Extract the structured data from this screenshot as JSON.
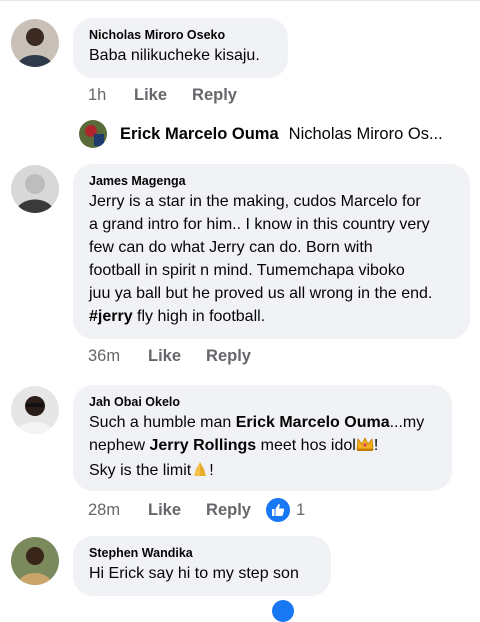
{
  "comments": [
    {
      "name": "Nicholas Miroro Oseko",
      "text": "Baba nilikucheke kisaju.",
      "time": "1h",
      "like": "Like",
      "reply": "Reply"
    },
    {
      "name": "James Magenga",
      "text_line1": "Jerry is a star in the making, cudos Marcelo for",
      "text_line2": "a grand intro for him.. I know in this country very",
      "text_line3": "few can do what Jerry can do. Born with",
      "text_line4": "football in spirit n mind. Tumemchapa viboko",
      "text_line5": "juu ya ball but he proved us all wrong in the end.",
      "hashtag": "#jerry",
      "text_line6_rest": " fly high in football.",
      "time": "36m",
      "like": "Like",
      "reply": "Reply"
    },
    {
      "name": "Jah Obai Okelo",
      "text_pre": "Such a humble man ",
      "mention1": "Erick Marcelo Ouma",
      "text_mid": "...my",
      "text_line2_pre": "nephew ",
      "mention2": "Jerry Rollings",
      "text_line2_post": " meet hos idol",
      "text_line2_end": "!",
      "text_line3": "Sky is the limit",
      "text_line3_end": "!",
      "time": "28m",
      "like": "Like",
      "reply": "Reply",
      "reaction_count": "1"
    },
    {
      "name": "Stephen Wandika",
      "text": "Hi Erick say hi to my step son"
    }
  ],
  "reply_preview": {
    "name": "Erick Marcelo Ouma",
    "text": "Nicholas Miroro Os..."
  },
  "icons": {
    "like_reaction": "thumbs-up-icon",
    "crown_emoji": "crown-icon",
    "pray_emoji": "folded-hands-icon"
  },
  "colors": {
    "bubble": "#f0f2f5",
    "secondary_text": "#65676b",
    "like_blue": "#1877f2"
  }
}
